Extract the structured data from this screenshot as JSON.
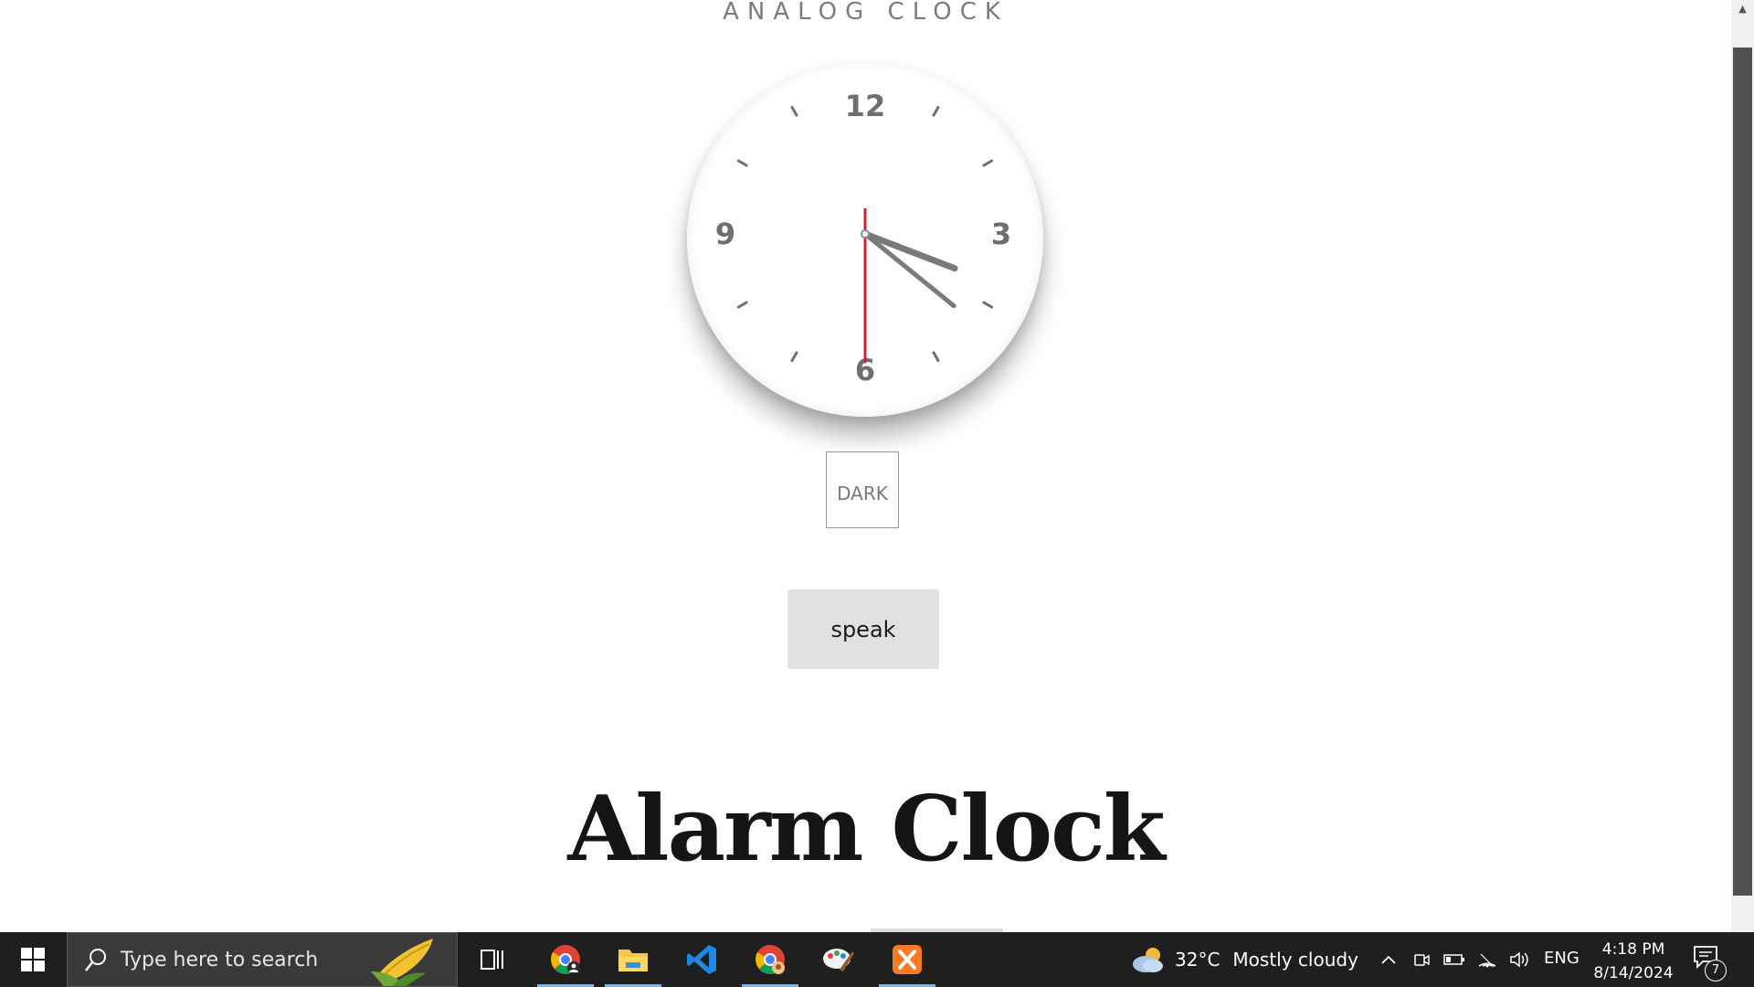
{
  "page": {
    "title": "ANALOG CLOCK",
    "numerals": {
      "n12": "12",
      "n3": "3",
      "n6": "6",
      "n9": "9"
    },
    "clock_time": {
      "hour": 4,
      "minute": 18,
      "second": 30
    },
    "theme_button_label": "DARK",
    "speak_button_label": "speak",
    "heading": "Alarm Clock",
    "colors": {
      "second_hand": "#d0202a",
      "hands": "#7a7a7a",
      "text": "#151515"
    }
  },
  "taskbar": {
    "search_placeholder": "Type here to search",
    "apps": [
      "chrome-profile-icon",
      "file-explorer-icon",
      "vscode-icon",
      "chrome-icon",
      "paint-icon",
      "xampp-icon"
    ],
    "weather": {
      "temp": "32°C",
      "condition": "Mostly cloudy"
    },
    "language": "ENG",
    "time": "4:18 PM",
    "date": "8/14/2024",
    "notification_count": "7"
  }
}
